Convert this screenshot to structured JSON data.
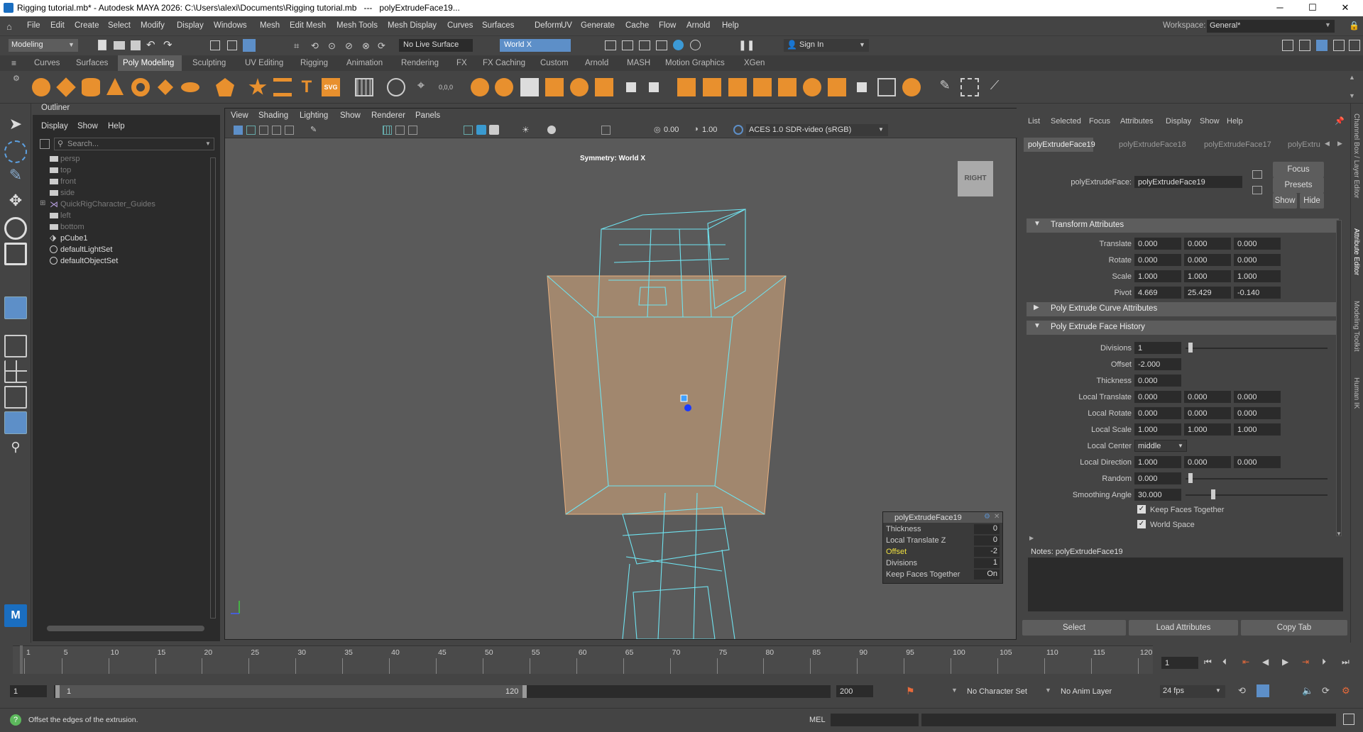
{
  "window": {
    "title": "Rigging tutorial.mb* - Autodesk MAYA 2026: C:\\Users\\alexi\\Documents\\Rigging tutorial.mb   ---   polyExtrudeFace19...",
    "minimize": "─",
    "maximize": "☐",
    "close": "✕"
  },
  "menubar": {
    "items": [
      "File",
      "Edit",
      "Create",
      "Select",
      "Modify",
      "Display",
      "Windows",
      "Mesh",
      "Edit Mesh",
      "Mesh Tools",
      "Mesh Display",
      "Curves",
      "Surfaces",
      "Deform",
      "UV",
      "Generate",
      "Cache",
      "Flow",
      "Arnold",
      "Help"
    ],
    "workspace_label": "Workspace:",
    "workspace_value": "General*"
  },
  "statusline": {
    "mode": "Modeling",
    "live_surface": "No Live Surface",
    "symmetry": "World X",
    "sign_in": "Sign In"
  },
  "shelf": {
    "tabs": [
      "Curves",
      "Surfaces",
      "Poly Modeling",
      "Sculpting",
      "UV Editing",
      "Rigging",
      "Animation",
      "Rendering",
      "FX",
      "FX Caching",
      "Custom",
      "Arnold",
      "MASH",
      "Motion Graphics",
      "XGen"
    ],
    "active_tab": "Poly Modeling"
  },
  "outliner": {
    "title": "Outliner",
    "menu": [
      "Display",
      "Show",
      "Help"
    ],
    "search_placeholder": "Search...",
    "items": [
      {
        "label": "persp",
        "dim": true
      },
      {
        "label": "top",
        "dim": true
      },
      {
        "label": "front",
        "dim": true
      },
      {
        "label": "side",
        "dim": true
      },
      {
        "label": "QuickRigCharacter_Guides",
        "dim": true
      },
      {
        "label": "left",
        "dim": true
      },
      {
        "label": "bottom",
        "dim": true
      },
      {
        "label": "pCube1",
        "dim": false
      },
      {
        "label": "defaultLightSet",
        "dim": false
      },
      {
        "label": "defaultObjectSet",
        "dim": false
      }
    ]
  },
  "viewport": {
    "menu": [
      "View",
      "Shading",
      "Lighting",
      "Show",
      "Renderer",
      "Panels"
    ],
    "exposure": "0.00",
    "gamma": "1.00",
    "colorspace": "ACES 1.0 SDR-video (sRGB)",
    "symmetry_label": "Symmetry: World X",
    "viewcube": "RIGHT"
  },
  "channel_popup": {
    "title": "polyExtrudeFace19",
    "rows": [
      {
        "label": "Thickness",
        "value": "0",
        "highlight": false
      },
      {
        "label": "Local Translate Z",
        "value": "0",
        "highlight": false
      },
      {
        "label": "Offset",
        "value": "-2",
        "highlight": true
      },
      {
        "label": "Divisions",
        "value": "1",
        "highlight": false
      },
      {
        "label": "Keep Faces Together",
        "value": "On",
        "highlight": false
      }
    ]
  },
  "attribute_editor": {
    "menu": [
      "List",
      "Selected",
      "Focus",
      "Attributes",
      "Display",
      "Show",
      "Help"
    ],
    "tabs": [
      "polyExtrudeFace19",
      "polyExtrudeFace18",
      "polyExtrudeFace17",
      "polyExtru"
    ],
    "node_label": "polyExtrudeFace:",
    "node_value": "polyExtrudeFace19",
    "buttons": {
      "focus": "Focus",
      "presets": "Presets",
      "show": "Show",
      "hide": "Hide"
    },
    "sections": {
      "transform": "Transform Attributes",
      "curve": "Poly Extrude Curve Attributes",
      "history": "Poly Extrude Face History"
    },
    "translate": {
      "label": "Translate",
      "v": [
        "0.000",
        "0.000",
        "0.000"
      ]
    },
    "rotate": {
      "label": "Rotate",
      "v": [
        "0.000",
        "0.000",
        "0.000"
      ]
    },
    "scale": {
      "label": "Scale",
      "v": [
        "1.000",
        "1.000",
        "1.000"
      ]
    },
    "pivot": {
      "label": "Pivot",
      "v": [
        "4.669",
        "25.429",
        "-0.140"
      ]
    },
    "divisions": {
      "label": "Divisions",
      "v": "1"
    },
    "offset": {
      "label": "Offset",
      "v": "-2.000"
    },
    "thickness": {
      "label": "Thickness",
      "v": "0.000"
    },
    "local_translate": {
      "label": "Local Translate",
      "v": [
        "0.000",
        "0.000",
        "0.000"
      ]
    },
    "local_rotate": {
      "label": "Local Rotate",
      "v": [
        "0.000",
        "0.000",
        "0.000"
      ]
    },
    "local_scale": {
      "label": "Local Scale",
      "v": [
        "1.000",
        "1.000",
        "1.000"
      ]
    },
    "local_center": {
      "label": "Local Center",
      "v": "middle"
    },
    "local_direction": {
      "label": "Local Direction",
      "v": [
        "1.000",
        "0.000",
        "0.000"
      ]
    },
    "random": {
      "label": "Random",
      "v": "0.000"
    },
    "smoothing": {
      "label": "Smoothing Angle",
      "v": "30.000"
    },
    "keep_faces": "Keep Faces Together",
    "world_space": "World Space",
    "notes_label": "Notes:  polyExtrudeFace19",
    "bottom_buttons": [
      "Select",
      "Load Attributes",
      "Copy Tab"
    ]
  },
  "right_strip": [
    "Channel Box / Layer Editor",
    "Attribute Editor",
    "Modeling Toolkit",
    "Human IK"
  ],
  "timeline": {
    "ticks": [
      "1",
      "5",
      "10",
      "15",
      "20",
      "25",
      "30",
      "35",
      "40",
      "45",
      "50",
      "55",
      "60",
      "65",
      "70",
      "75",
      "80",
      "85",
      "90",
      "95",
      "100",
      "105",
      "110",
      "115",
      "120"
    ],
    "current_frame": "1"
  },
  "range": {
    "start": "1",
    "inner_start": "1",
    "inner_end": "120",
    "end": "200",
    "character_set": "No Character Set",
    "anim_layer": "No Anim Layer",
    "fps": "24 fps"
  },
  "cmdline": {
    "help": "Offset the edges of the extrusion.",
    "mel": "MEL"
  }
}
